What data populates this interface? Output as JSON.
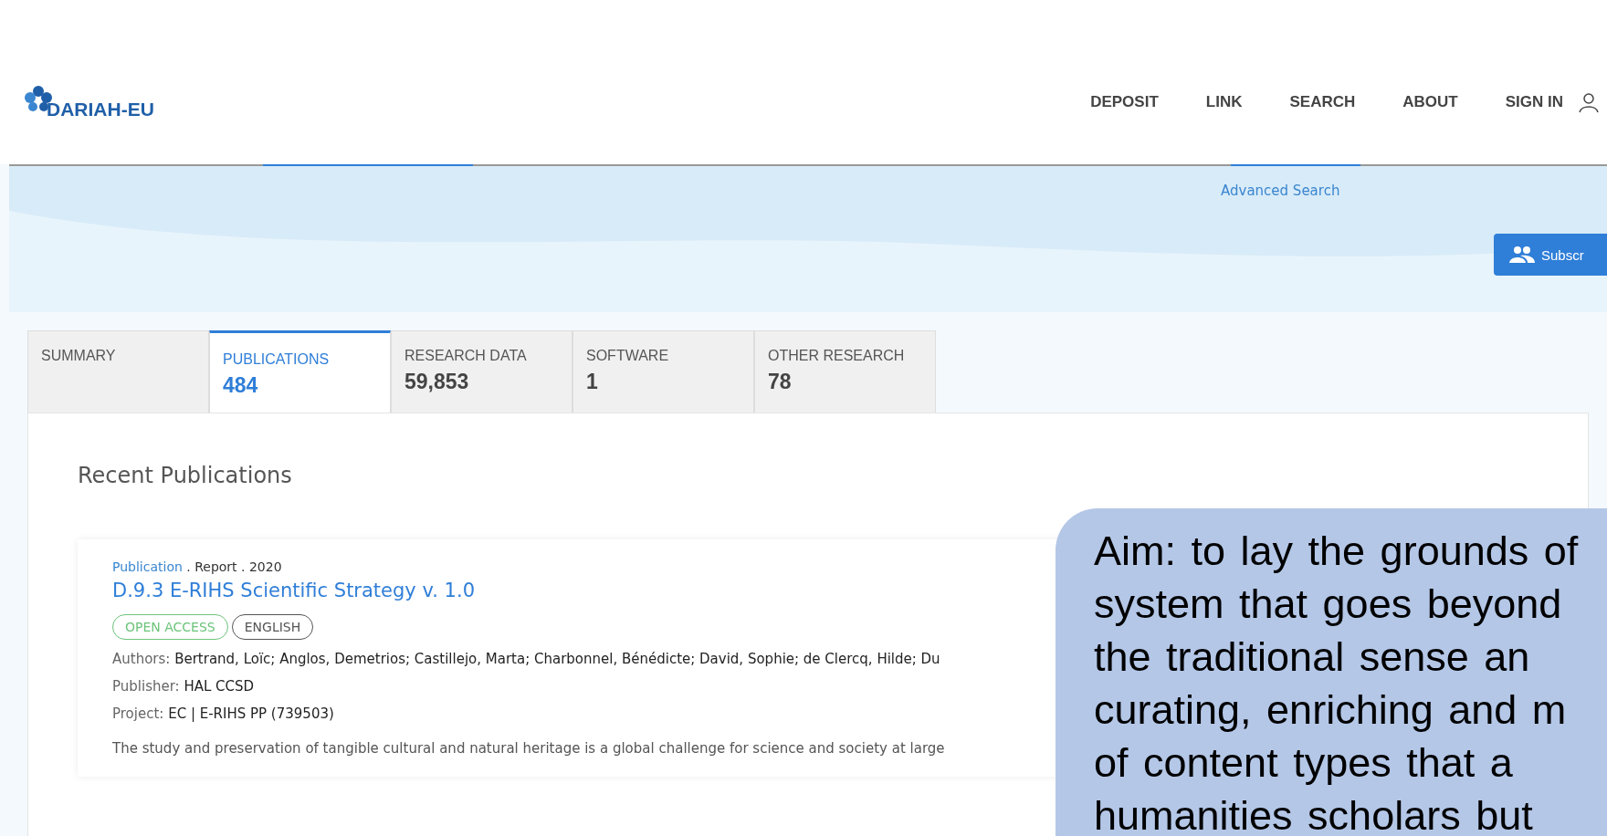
{
  "header": {
    "logo_text": "DARIAH-EU",
    "nav": [
      {
        "label": "DEPOSIT"
      },
      {
        "label": "LINK"
      },
      {
        "label": "SEARCH"
      },
      {
        "label": "ABOUT"
      }
    ],
    "sign_in": "SIGN IN"
  },
  "banner": {
    "advanced_search": "Advanced Search",
    "subscribe_button": "Subscr"
  },
  "tabs": [
    {
      "label": "SUMMARY",
      "selected": false
    },
    {
      "label": "PUBLICATIONS",
      "count": "484",
      "selected": true
    },
    {
      "label": "RESEARCH DATA",
      "count": "59,853",
      "selected": false
    },
    {
      "label": "SOFTWARE",
      "count": "1",
      "selected": false
    },
    {
      "label": "OTHER RESEARCH",
      "count": "78",
      "selected": false
    }
  ],
  "section_title": "Recent Publications",
  "results": [
    {
      "type_link": "Publication",
      "meta": " . Report . 2020",
      "title": "D.9.3 E-RIHS Scientific Strategy v. 1.0",
      "badges": [
        {
          "label": "OPEN ACCESS",
          "color": "#6cc47a"
        },
        {
          "label": "ENGLISH",
          "color": "#555555"
        }
      ],
      "fields": [
        {
          "label": "Authors:",
          "value": "Bertrand, Loïc; Anglos, Demetrios; Castillejo, Marta; Charbonnel, Bénédicte; David, Sophie; de Clercq, Hilde; Du"
        },
        {
          "label": "Publisher:",
          "value": "HAL CCSD"
        },
        {
          "label": "Project:",
          "value": "EC | E-RIHS PP (739503)"
        }
      ],
      "abstract": "The study and preservation of tangible cultural and natural heritage is a global challenge for science and society at large"
    }
  ],
  "callout": {
    "lines": [
      "Aim: to lay the grounds of",
      "system that goes beyond",
      "the traditional sense an",
      "curating, enriching and m",
      "of content types that a",
      "humanities scholars but"
    ]
  }
}
